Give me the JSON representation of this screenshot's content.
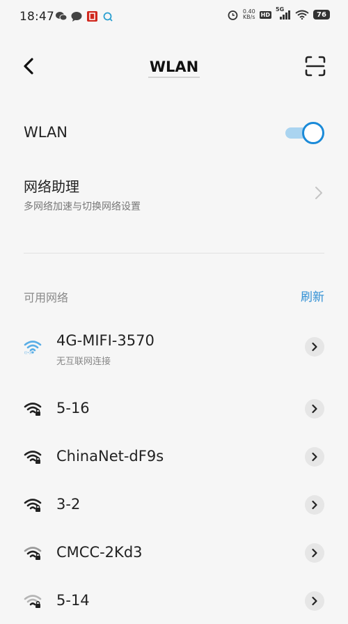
{
  "status_bar": {
    "time": "18:47",
    "net_speed_value": "0.40",
    "net_speed_unit": "KB/s",
    "hd_badge": "HD",
    "signal_label": "5G",
    "battery": "76",
    "left_icons": [
      "wechat-icon",
      "chat-bubble-icon",
      "app-badge-icon",
      "sync-icon"
    ],
    "right_icons": [
      "alarm-icon",
      "hd-icon",
      "cellular-signal-icon",
      "wifi-signal-icon",
      "battery-icon"
    ]
  },
  "header": {
    "title": "WLAN",
    "back_icon": "back-arrow-icon",
    "scan_icon": "scan-icon"
  },
  "wlan_toggle": {
    "label": "WLAN",
    "enabled": true
  },
  "assistant": {
    "title": "网络助理",
    "subtitle": "多网络加速与切换网络设置"
  },
  "available": {
    "title": "可用网络",
    "refresh_label": "刷新"
  },
  "networks": [
    {
      "name": "4G-MIFI-3570",
      "status": "无互联网连接",
      "connected": true,
      "secured": false
    },
    {
      "name": "5-16",
      "status": "",
      "connected": false,
      "secured": true
    },
    {
      "name": "ChinaNet-dF9s",
      "status": "",
      "connected": false,
      "secured": true
    },
    {
      "name": "3-2",
      "status": "",
      "connected": false,
      "secured": true
    },
    {
      "name": "CMCC-2Kd3",
      "status": "",
      "connected": false,
      "secured": true
    },
    {
      "name": "5-14",
      "status": "",
      "connected": false,
      "secured": true
    }
  ],
  "colors": {
    "accent": "#1a8ad8",
    "refresh": "#2f8fd4",
    "background": "#f6f6f6",
    "connected_wifi": "#2f8fd4"
  }
}
